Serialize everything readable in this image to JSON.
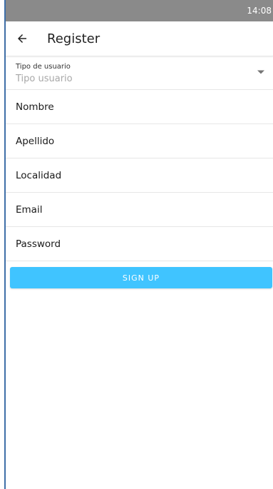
{
  "status_bar": {
    "time": "14:08"
  },
  "app_bar": {
    "title": "Register",
    "back_icon": "arrow-left-icon"
  },
  "form": {
    "tipo": {
      "label": "Tipo de usuario",
      "placeholder": "Tipo usuario",
      "icon": "dropdown-arrow-icon"
    },
    "fields": [
      {
        "placeholder": "Nombre"
      },
      {
        "placeholder": "Apellido"
      },
      {
        "placeholder": "Localidad"
      },
      {
        "placeholder": "Email"
      },
      {
        "placeholder": "Password"
      }
    ],
    "submit_label": "SIGN UP"
  },
  "colors": {
    "status_bar": "#8a8a8a",
    "primary_button": "#40c4ff",
    "frame_line": "#3f6fa8"
  }
}
